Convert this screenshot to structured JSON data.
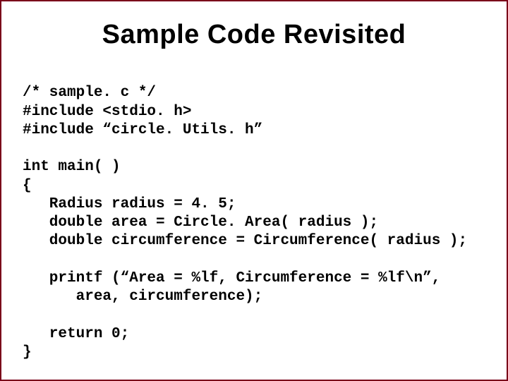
{
  "title": "Sample Code Revisited",
  "code": {
    "l1": "/* sample. c */",
    "l2": "#include <stdio. h>",
    "l3": "#include “circle. Utils. h”",
    "l4": "",
    "l5": "int main( )",
    "l6": "{",
    "l7": "   Radius radius = 4. 5;",
    "l8": "   double area = Circle. Area( radius );",
    "l9": "   double circumference = Circumference( radius );",
    "l10": "",
    "l11": "   printf (“Area = %lf, Circumference = %lf\\n”,",
    "l12": "      area, circumference);",
    "l13": "",
    "l14": "   return 0;",
    "l15": "}"
  }
}
